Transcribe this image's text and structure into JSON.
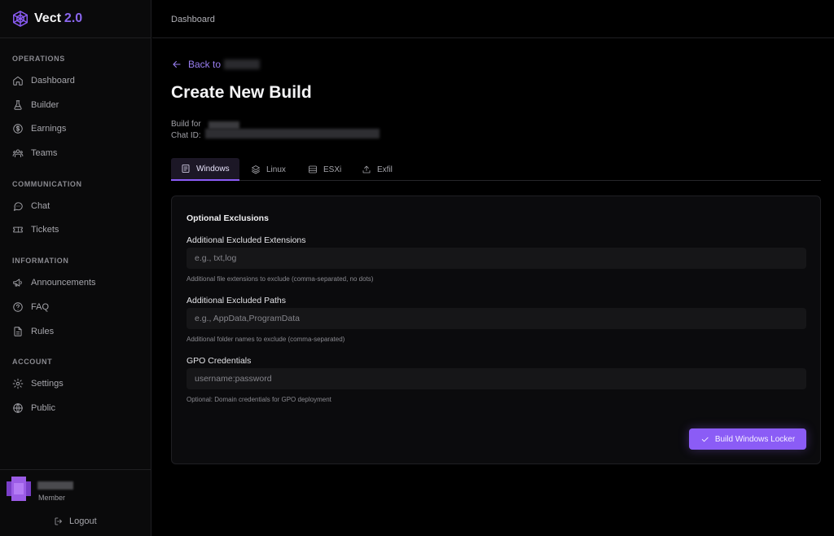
{
  "brand": {
    "name": "Vect",
    "version": "2.0",
    "accent": "#8b5cf6"
  },
  "sidebar": {
    "sections": [
      {
        "title": "OPERATIONS",
        "items": [
          {
            "label": "Dashboard",
            "icon": "home-icon"
          },
          {
            "label": "Builder",
            "icon": "flask-icon"
          },
          {
            "label": "Earnings",
            "icon": "dollar-icon"
          },
          {
            "label": "Teams",
            "icon": "users-icon"
          }
        ]
      },
      {
        "title": "COMMUNICATION",
        "items": [
          {
            "label": "Chat",
            "icon": "chat-icon"
          },
          {
            "label": "Tickets",
            "icon": "ticket-icon"
          }
        ]
      },
      {
        "title": "INFORMATION",
        "items": [
          {
            "label": "Announcements",
            "icon": "megaphone-icon"
          },
          {
            "label": "FAQ",
            "icon": "help-icon"
          },
          {
            "label": "Rules",
            "icon": "document-icon"
          }
        ]
      },
      {
        "title": "ACCOUNT",
        "items": [
          {
            "label": "Settings",
            "icon": "gear-icon"
          },
          {
            "label": "Public",
            "icon": "globe-icon"
          }
        ]
      }
    ],
    "user": {
      "role": "Member"
    },
    "logout_label": "Logout"
  },
  "topbar": {
    "title": "Dashboard"
  },
  "main": {
    "back_label": "Back to",
    "page_title": "Create New Build",
    "build_for_label": "Build for",
    "chat_id_label": "Chat ID:",
    "tabs": [
      {
        "label": "Windows",
        "icon": "file-icon",
        "active": true
      },
      {
        "label": "Linux",
        "icon": "layers-icon",
        "active": false
      },
      {
        "label": "ESXi",
        "icon": "server-icon",
        "active": false
      },
      {
        "label": "Exfil",
        "icon": "upload-icon",
        "active": false
      }
    ],
    "card": {
      "title": "Optional Exclusions",
      "fields": [
        {
          "label": "Additional Excluded Extensions",
          "value": "",
          "placeholder": "e.g., txt,log",
          "help": "Additional file extensions to exclude (comma-separated, no dots)"
        },
        {
          "label": "Additional Excluded Paths",
          "value": "",
          "placeholder": "e.g., AppData,ProgramData",
          "help": "Additional folder names to exclude (comma-separated)"
        },
        {
          "label": "GPO Credentials",
          "value": "",
          "placeholder": "username:password",
          "help": "Optional: Domain credentials for GPO deployment"
        }
      ],
      "submit_label": "Build Windows Locker"
    }
  }
}
